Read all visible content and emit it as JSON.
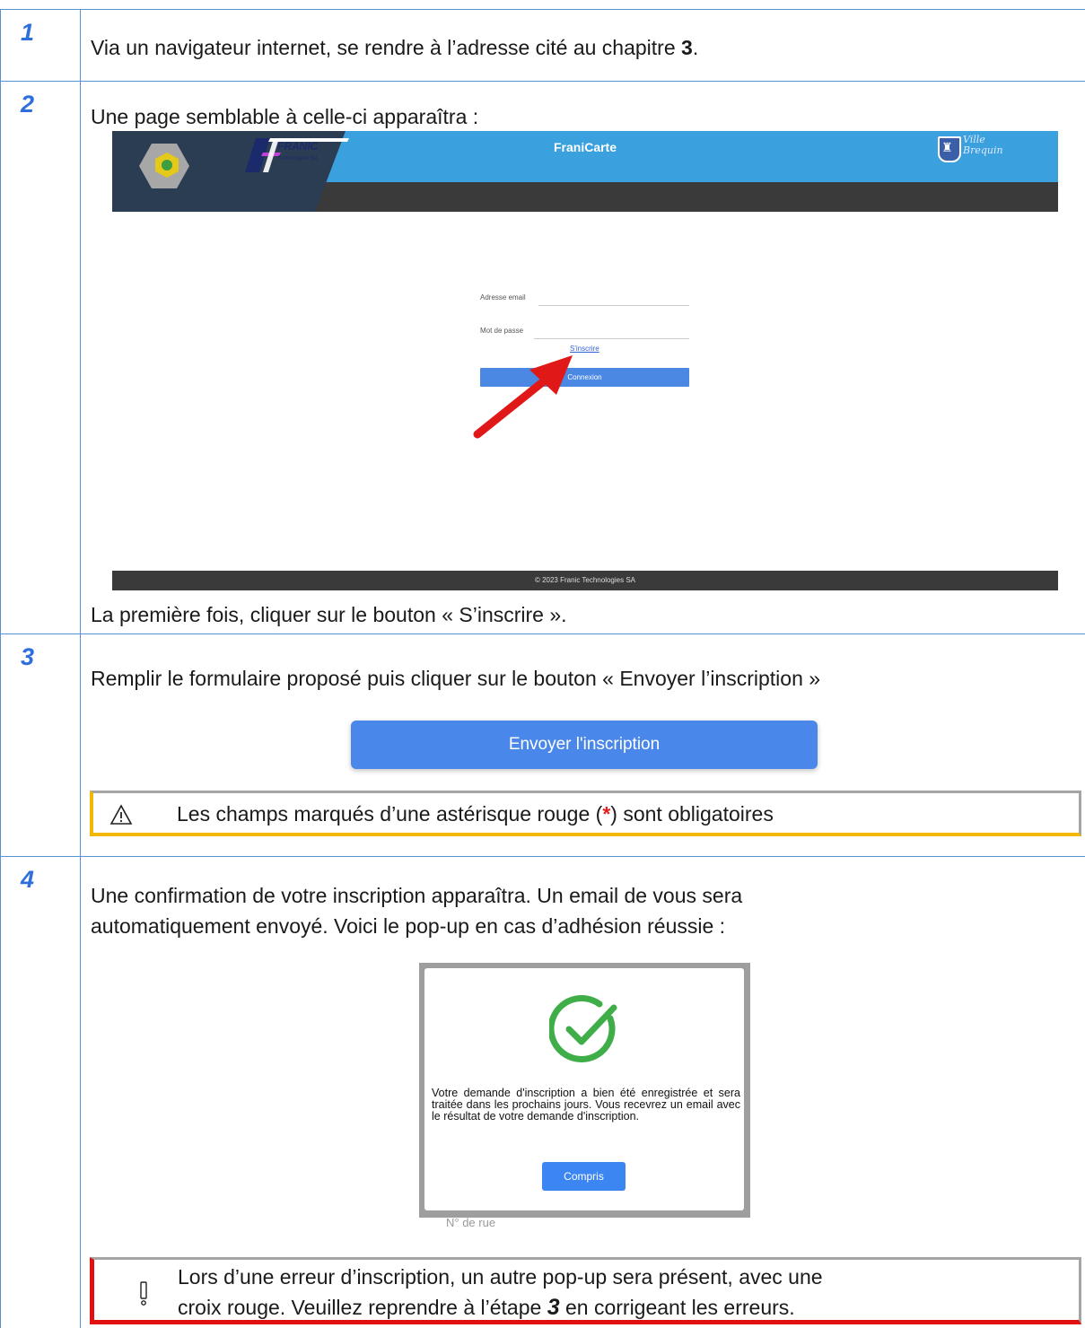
{
  "steps": [
    {
      "number": "1",
      "text_before": "Via un navigateur internet, se rendre à l’adresse cité au chapitre ",
      "text_bold": "3",
      "text_after": "."
    },
    {
      "number": "2",
      "text": "Une page semblable à celle-ci apparaîtra :",
      "after_text": "La première fois, cliquer sur le bouton « S’inscrire »."
    },
    {
      "number": "3",
      "text": "Remplir le formulaire proposé puis cliquer sur le bouton « Envoyer l’inscription »",
      "button_label": "Envoyer l'inscription",
      "warning_before": "Les champs marqués d’une astérisque rouge (",
      "warning_star": "*",
      "warning_after": ") sont obligatoires"
    },
    {
      "number": "4",
      "text_line1": "Une confirmation de votre inscription apparaîtra. Un email de vous sera",
      "text_line2": "automatiquement envoyé. Voici le pop-up en cas d’adhésion réussie :",
      "error_line1": "Lors d’une erreur d’inscription, un autre pop-up sera présent, avec une",
      "error_line2_before": "croix rouge. Veuillez reprendre à l’étape ",
      "error_line2_step": "3",
      "error_line2_after": " en corrigeant les erreurs."
    }
  ],
  "login_screenshot": {
    "app_title": "FraniCarte",
    "logo_text": "FRANIC",
    "logo_subtext": "Technologies SA",
    "city_line1": "Ville",
    "city_line2": "Brequin",
    "email_label": "Adresse email",
    "password_label": "Mot de passe",
    "register_link": "S'inscrire",
    "login_button": "Connexion",
    "footer": "© 2023 Franic Technologies SA",
    "colors": {
      "header": "#3aa0de",
      "dark_bar": "#3a3a3a",
      "button": "#4a88e4",
      "arrow": "#e01818"
    }
  },
  "popup_screenshot": {
    "message": "Votre demande d'inscription a bien été enregistrée et sera traitée dans les prochains jours. Vous recevrez un email avec le résultat de votre demande d'inscription.",
    "button": "Compris",
    "faded_bottom": "N° de rue",
    "icon": "check-circle-icon",
    "icon_color": "#3fae49"
  },
  "colors": {
    "step_number": "#2f6fdc",
    "table_border": "#5b8fd4",
    "warning_border": "#f2b700",
    "error_border": "#e01010",
    "asterisk": "#e02020"
  }
}
